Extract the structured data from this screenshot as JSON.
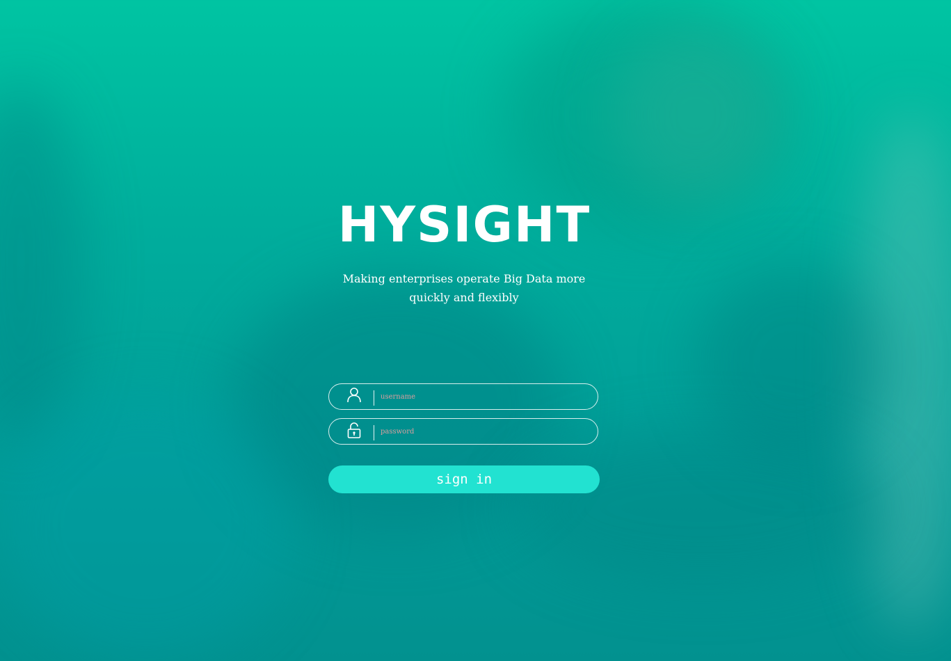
{
  "brand": {
    "logo_text": "HYSIGHT"
  },
  "tagline": "Making enterprises operate Big Data more quickly and flexibly",
  "login": {
    "username": {
      "placeholder": "username",
      "value": "",
      "icon": "user-icon"
    },
    "password": {
      "placeholder": "password",
      "value": "",
      "icon": "lock-icon"
    },
    "signin_label": "sign in"
  },
  "colors": {
    "background_top": "#00c4a2",
    "background_bottom": "#02918f",
    "accent_button": "#22e2d1",
    "text": "#ffffff",
    "placeholder": "#f2a0a0"
  }
}
